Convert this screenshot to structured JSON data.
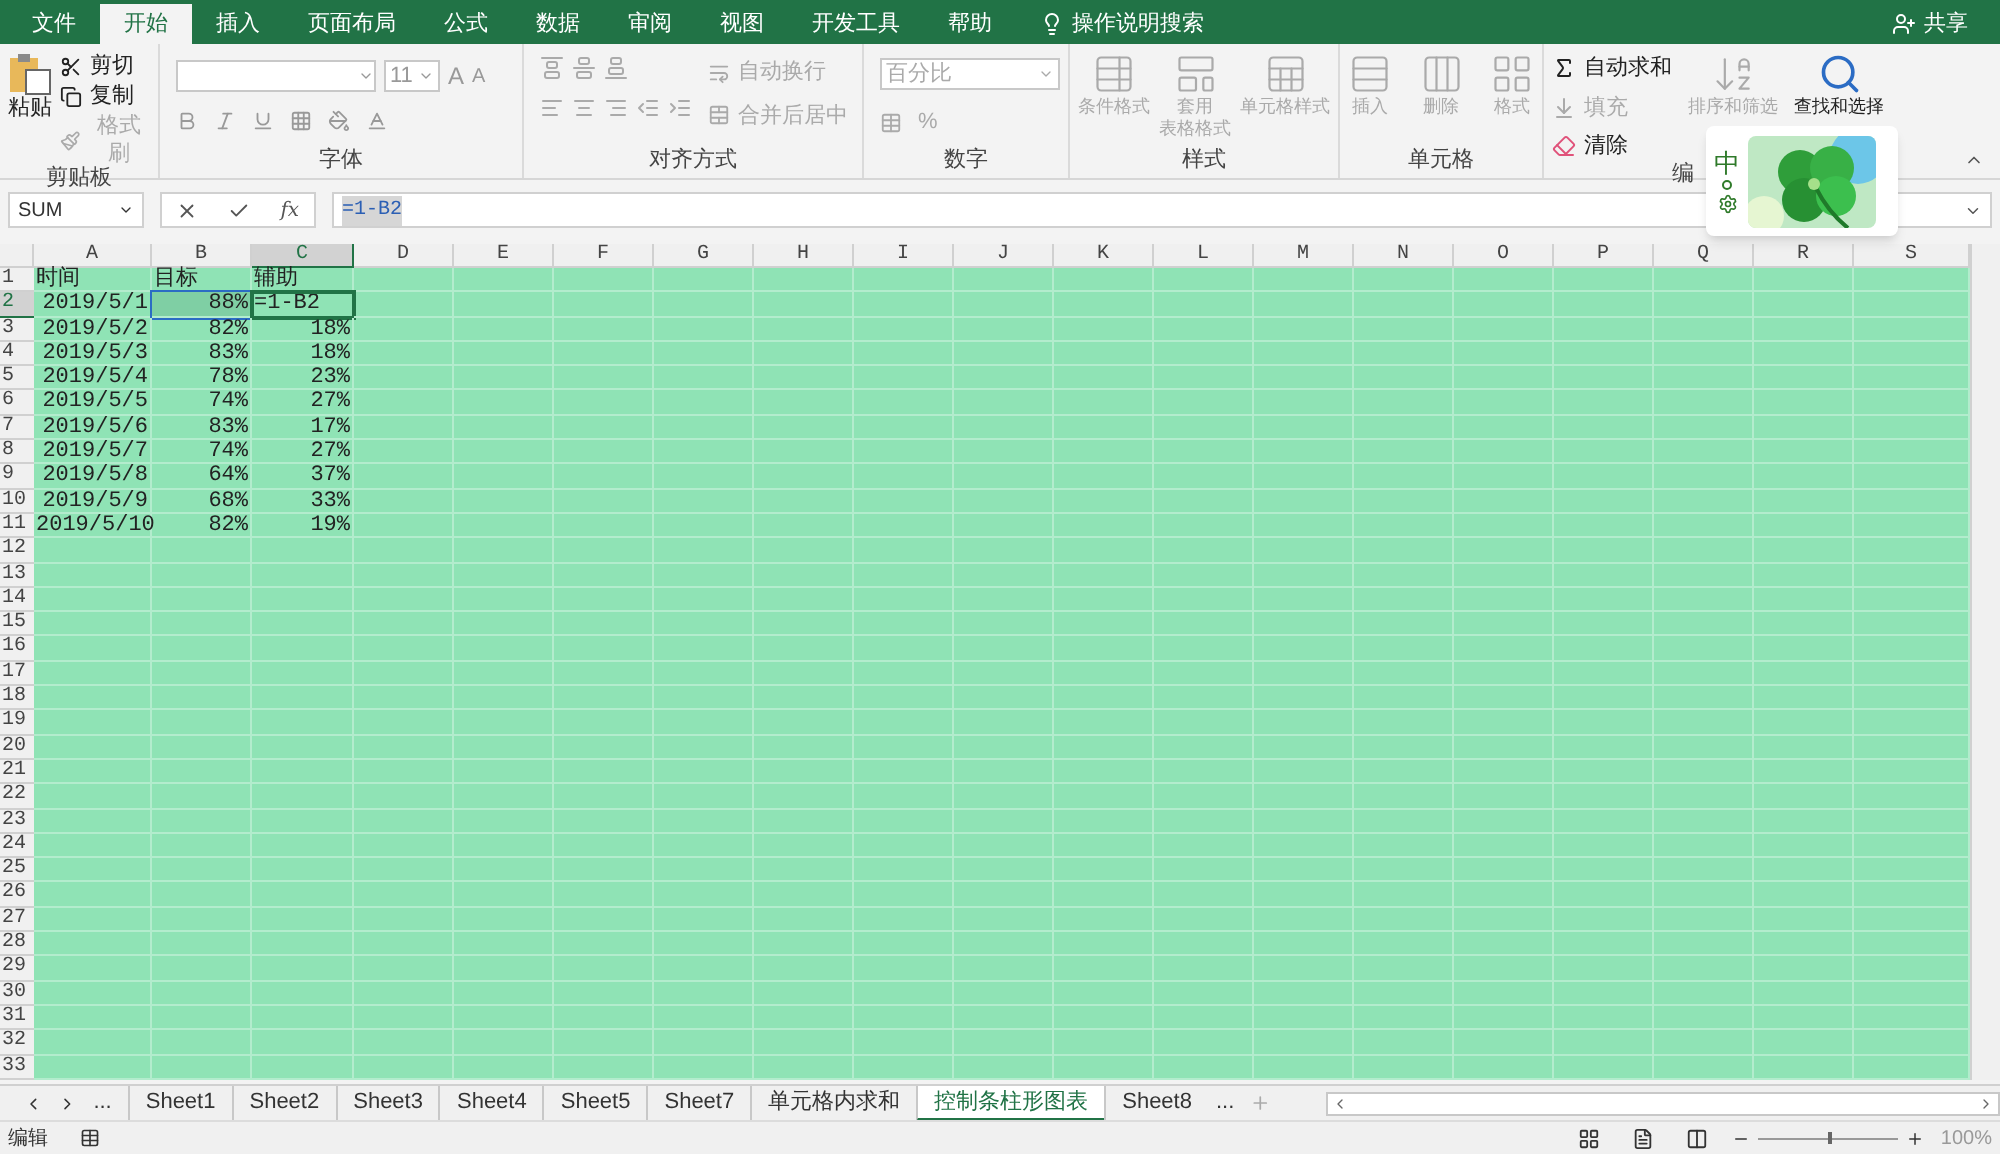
{
  "menu_tabs": [
    {
      "label": "文件",
      "selected": false
    },
    {
      "label": "开始",
      "selected": true
    },
    {
      "label": "插入",
      "selected": false
    },
    {
      "label": "页面布局",
      "selected": false
    },
    {
      "label": "公式",
      "selected": false
    },
    {
      "label": "数据",
      "selected": false
    },
    {
      "label": "审阅",
      "selected": false
    },
    {
      "label": "视图",
      "selected": false
    },
    {
      "label": "开发工具",
      "selected": false
    },
    {
      "label": "帮助",
      "selected": false
    }
  ],
  "tell_me": "操作说明搜索",
  "share": "共享",
  "ribbon": {
    "clipboard": {
      "label": "剪贴板",
      "paste": "粘贴",
      "items": [
        {
          "label": "剪切",
          "disabled": false
        },
        {
          "label": "复制",
          "disabled": false
        },
        {
          "label": "格式刷",
          "disabled": true
        }
      ]
    },
    "font": {
      "label": "字体",
      "size": "11",
      "grow": "A",
      "shrink": "A"
    },
    "alignment": {
      "label": "对齐方式",
      "wrap": "自动换行",
      "merge": "合并后居中"
    },
    "number": {
      "label": "数字",
      "format": "百分比",
      "percent": "%"
    },
    "styles": {
      "label": "样式",
      "items": [
        {
          "lines": [
            "条件格式"
          ],
          "disabled": true
        },
        {
          "lines": [
            "套用",
            "表格格式"
          ],
          "disabled": true
        },
        {
          "lines": [
            "单元格样式"
          ],
          "disabled": true
        }
      ]
    },
    "cells": {
      "label": "单元格",
      "items": [
        {
          "lines": [
            "插入"
          ],
          "disabled": true
        },
        {
          "lines": [
            "删除"
          ],
          "disabled": true
        },
        {
          "lines": [
            "格式"
          ],
          "disabled": true
        }
      ]
    },
    "editing": {
      "label": "编",
      "autosum": "自动求和",
      "fill": "填充",
      "clear": "清除",
      "sort": "排序和筛选",
      "find": "查找和选择"
    }
  },
  "ime_toolbar": {
    "mode": "中"
  },
  "name_box": "SUM",
  "formula": "=1-B2",
  "fx": "fx",
  "columns": [
    {
      "letter": "A",
      "selected": false
    },
    {
      "letter": "B",
      "selected": false
    },
    {
      "letter": "C",
      "selected": true
    },
    {
      "letter": "D",
      "selected": false
    },
    {
      "letter": "E",
      "selected": false
    },
    {
      "letter": "F",
      "selected": false
    },
    {
      "letter": "G",
      "selected": false
    },
    {
      "letter": "H",
      "selected": false
    },
    {
      "letter": "I",
      "selected": false
    },
    {
      "letter": "J",
      "selected": false
    },
    {
      "letter": "K",
      "selected": false
    },
    {
      "letter": "L",
      "selected": false
    },
    {
      "letter": "M",
      "selected": false
    },
    {
      "letter": "N",
      "selected": false
    },
    {
      "letter": "O",
      "selected": false
    },
    {
      "letter": "P",
      "selected": false
    },
    {
      "letter": "Q",
      "selected": false
    },
    {
      "letter": "R",
      "selected": false
    },
    {
      "letter": "S",
      "selected": false
    }
  ],
  "rows": [
    {
      "number": "1",
      "selected": false,
      "cells": [
        {
          "text": "时间",
          "kind": "text",
          "highlighted": false,
          "editing": false
        },
        {
          "text": "目标",
          "kind": "text",
          "highlighted": false,
          "editing": false
        },
        {
          "text": "辅助",
          "kind": "text",
          "highlighted": false,
          "editing": false
        }
      ]
    },
    {
      "number": "2",
      "selected": true,
      "cells": [
        {
          "text": "2019/5/1",
          "kind": "number",
          "highlighted": false,
          "editing": false
        },
        {
          "text": "88%",
          "kind": "number",
          "highlighted": true,
          "editing": false
        },
        {
          "text": "=1-B2",
          "kind": "text",
          "highlighted": false,
          "editing": true
        }
      ]
    },
    {
      "number": "3",
      "selected": false,
      "cells": [
        {
          "text": "2019/5/2",
          "kind": "number",
          "highlighted": false,
          "editing": false
        },
        {
          "text": "82%",
          "kind": "number",
          "highlighted": false,
          "editing": false
        },
        {
          "text": "18%",
          "kind": "number",
          "highlighted": false,
          "editing": false
        }
      ]
    },
    {
      "number": "4",
      "selected": false,
      "cells": [
        {
          "text": "2019/5/3",
          "kind": "number",
          "highlighted": false,
          "editing": false
        },
        {
          "text": "83%",
          "kind": "number",
          "highlighted": false,
          "editing": false
        },
        {
          "text": "18%",
          "kind": "number",
          "highlighted": false,
          "editing": false
        }
      ]
    },
    {
      "number": "5",
      "selected": false,
      "cells": [
        {
          "text": "2019/5/4",
          "kind": "number",
          "highlighted": false,
          "editing": false
        },
        {
          "text": "78%",
          "kind": "number",
          "highlighted": false,
          "editing": false
        },
        {
          "text": "23%",
          "kind": "number",
          "highlighted": false,
          "editing": false
        }
      ]
    },
    {
      "number": "6",
      "selected": false,
      "cells": [
        {
          "text": "2019/5/5",
          "kind": "number",
          "highlighted": false,
          "editing": false
        },
        {
          "text": "74%",
          "kind": "number",
          "highlighted": false,
          "editing": false
        },
        {
          "text": "27%",
          "kind": "number",
          "highlighted": false,
          "editing": false
        }
      ]
    },
    {
      "number": "7",
      "selected": false,
      "cells": [
        {
          "text": "2019/5/6",
          "kind": "number",
          "highlighted": false,
          "editing": false
        },
        {
          "text": "83%",
          "kind": "number",
          "highlighted": false,
          "editing": false
        },
        {
          "text": "17%",
          "kind": "number",
          "highlighted": false,
          "editing": false
        }
      ]
    },
    {
      "number": "8",
      "selected": false,
      "cells": [
        {
          "text": "2019/5/7",
          "kind": "number",
          "highlighted": false,
          "editing": false
        },
        {
          "text": "74%",
          "kind": "number",
          "highlighted": false,
          "editing": false
        },
        {
          "text": "27%",
          "kind": "number",
          "highlighted": false,
          "editing": false
        }
      ]
    },
    {
      "number": "9",
      "selected": false,
      "cells": [
        {
          "text": "2019/5/8",
          "kind": "number",
          "highlighted": false,
          "editing": false
        },
        {
          "text": "64%",
          "kind": "number",
          "highlighted": false,
          "editing": false
        },
        {
          "text": "37%",
          "kind": "number",
          "highlighted": false,
          "editing": false
        }
      ]
    },
    {
      "number": "10",
      "selected": false,
      "cells": [
        {
          "text": "2019/5/9",
          "kind": "number",
          "highlighted": false,
          "editing": false
        },
        {
          "text": "68%",
          "kind": "number",
          "highlighted": false,
          "editing": false
        },
        {
          "text": "33%",
          "kind": "number",
          "highlighted": false,
          "editing": false
        }
      ]
    },
    {
      "number": "11",
      "selected": false,
      "cells": [
        {
          "text": "2019/5/10",
          "kind": "number",
          "highlighted": false,
          "editing": false
        },
        {
          "text": "82%",
          "kind": "number",
          "highlighted": false,
          "editing": false
        },
        {
          "text": "19%",
          "kind": "number",
          "highlighted": false,
          "editing": false
        }
      ]
    },
    {
      "number": "12",
      "selected": false
    },
    {
      "number": "13",
      "selected": false
    },
    {
      "number": "14",
      "selected": false
    },
    {
      "number": "15",
      "selected": false
    },
    {
      "number": "16",
      "selected": false
    },
    {
      "number": "17",
      "selected": false
    },
    {
      "number": "18",
      "selected": false
    },
    {
      "number": "19",
      "selected": false
    },
    {
      "number": "20",
      "selected": false
    },
    {
      "number": "21",
      "selected": false
    },
    {
      "number": "22",
      "selected": false
    },
    {
      "number": "23",
      "selected": false
    },
    {
      "number": "24",
      "selected": false
    },
    {
      "number": "25",
      "selected": false
    },
    {
      "number": "26",
      "selected": false
    },
    {
      "number": "27",
      "selected": false
    },
    {
      "number": "28",
      "selected": false
    },
    {
      "number": "29",
      "selected": false
    },
    {
      "number": "30",
      "selected": false
    },
    {
      "number": "31",
      "selected": false
    },
    {
      "number": "32",
      "selected": false
    },
    {
      "number": "33",
      "selected": false
    }
  ],
  "sheet_nav": {
    "more_left": "...",
    "more_right": "..."
  },
  "sheets": [
    {
      "name": "Sheet1",
      "selected": false
    },
    {
      "name": "Sheet2",
      "selected": false
    },
    {
      "name": "Sheet3",
      "selected": false
    },
    {
      "name": "Sheet4",
      "selected": false
    },
    {
      "name": "Sheet5",
      "selected": false
    },
    {
      "name": "Sheet7",
      "selected": false
    },
    {
      "name": "单元格内求和",
      "selected": false
    },
    {
      "name": "控制条柱形图表",
      "selected": true
    },
    {
      "name": "Sheet8",
      "selected": false
    }
  ],
  "status_bar": {
    "mode": "编辑",
    "zoom": {
      "level": 0.5,
      "reading": "100%"
    }
  }
}
